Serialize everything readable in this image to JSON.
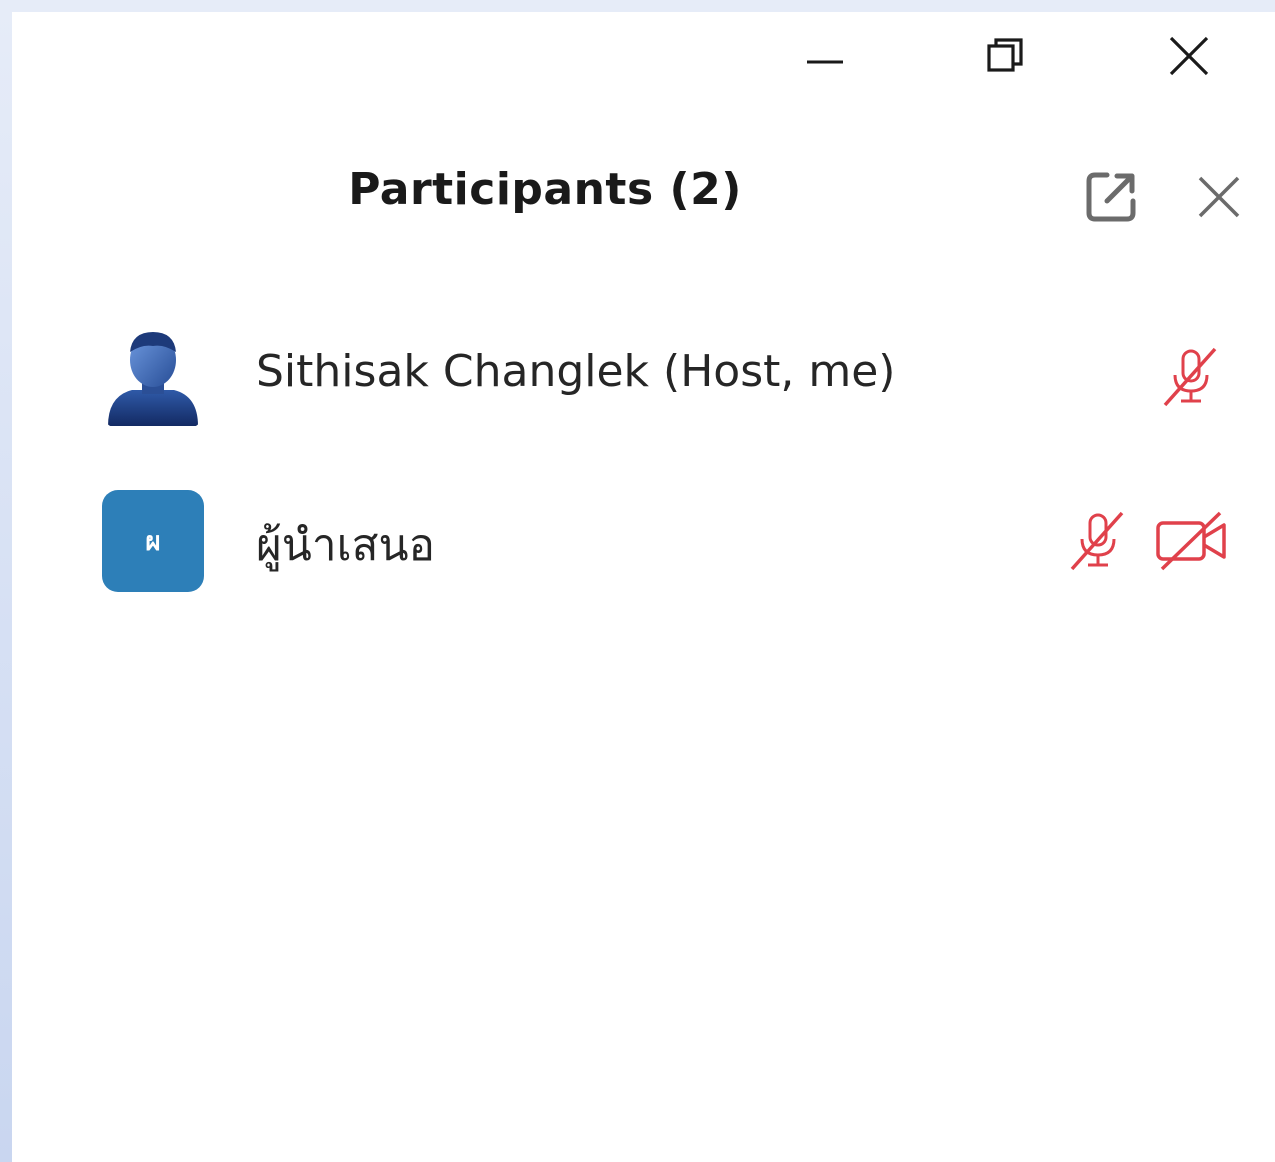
{
  "window": {
    "controls": {
      "minimize_icon": "minimize-icon",
      "restore_icon": "restore-icon",
      "close_icon": "close-icon"
    }
  },
  "panel": {
    "title": "Participants (2)",
    "popout_icon": "popout-icon",
    "close_icon": "close-icon"
  },
  "participants": [
    {
      "name": "Sithisak Changlek (Host, me)",
      "avatar": "user-photo",
      "mic": "muted",
      "video": null
    },
    {
      "name": "ผู้นำเสนอ",
      "avatar_initial": "ผ",
      "avatar_color": "#2d7fb8",
      "mic": "muted",
      "video": "off"
    }
  ],
  "colors": {
    "muted_red": "#e0414b",
    "avatar_blue": "#2d7fb8",
    "text": "#262626"
  }
}
